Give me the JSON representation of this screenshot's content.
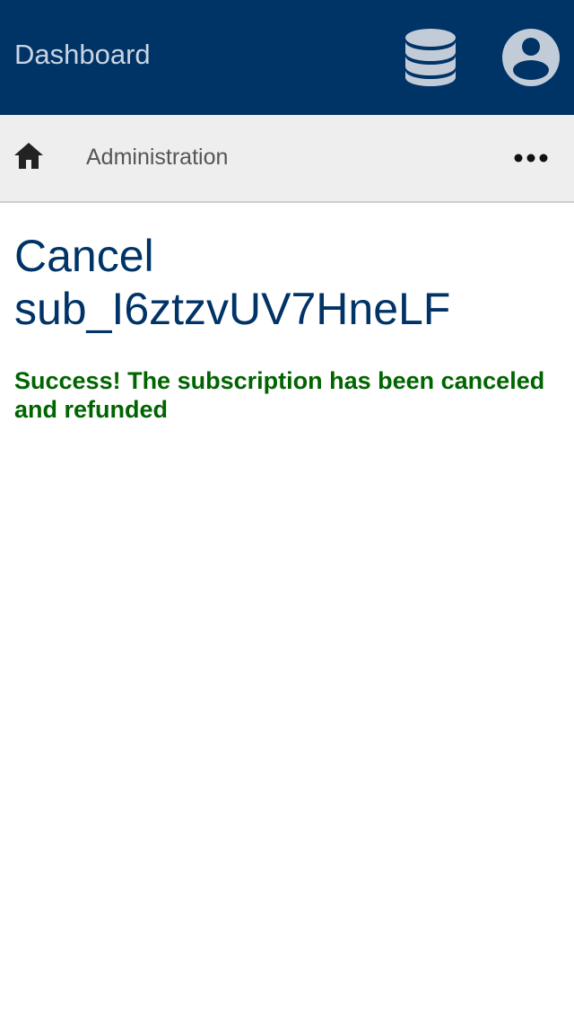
{
  "header": {
    "title": "Dashboard",
    "background_color": "#003366",
    "database_icon": "database-icon",
    "account_icon": "account-circle-icon"
  },
  "subnav": {
    "home_icon": "home-icon",
    "link_label": "Administration",
    "more_icon": "more-horizontal-icon"
  },
  "main": {
    "title_line1": "Cancel",
    "title_line2": "sub_I6ztzvUV7HneLF",
    "title_color": "#003366",
    "success_message": "Success! The subscription has been canceled and refunded",
    "success_color": "#006400"
  }
}
